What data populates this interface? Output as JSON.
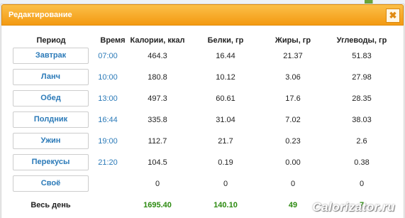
{
  "dialog": {
    "title": "Редактирование",
    "close_glyph": "✖"
  },
  "headers": [
    "Период",
    "Время",
    "Калории, ккал",
    "Белки, гр",
    "Жиры, гр",
    "Углеводы, гр"
  ],
  "rows": [
    {
      "period": "Завтрак",
      "time": "07:00",
      "cal": "464.3",
      "protein": "16.44",
      "fat": "21.37",
      "carbs": "51.83"
    },
    {
      "period": "Ланч",
      "time": "10:00",
      "cal": "180.8",
      "protein": "10.12",
      "fat": "3.06",
      "carbs": "27.98"
    },
    {
      "period": "Обед",
      "time": "13:00",
      "cal": "497.3",
      "protein": "60.61",
      "fat": "17.6",
      "carbs": "28.35"
    },
    {
      "period": "Полдник",
      "time": "16:44",
      "cal": "335.8",
      "protein": "31.04",
      "fat": "7.02",
      "carbs": "38.03"
    },
    {
      "period": "Ужин",
      "time": "19:00",
      "cal": "112.7",
      "protein": "21.7",
      "fat": "0.23",
      "carbs": "2.6"
    },
    {
      "period": "Перекусы",
      "time": "21:20",
      "cal": "104.5",
      "protein": "0.19",
      "fat": "0.00",
      "carbs": "0.38"
    },
    {
      "period": "Своё",
      "time": "",
      "cal": "0",
      "protein": "0",
      "fat": "0",
      "carbs": "0"
    }
  ],
  "total": {
    "label": "Весь день",
    "cal": "1695.40",
    "protein": "140.10",
    "fat": "49",
    "carbs": "7"
  },
  "watermark": "Calorizator.ru",
  "colors": {
    "title_bar": "#f39a12",
    "link_blue": "#2b7ab8",
    "total_green": "#2c8a10"
  }
}
